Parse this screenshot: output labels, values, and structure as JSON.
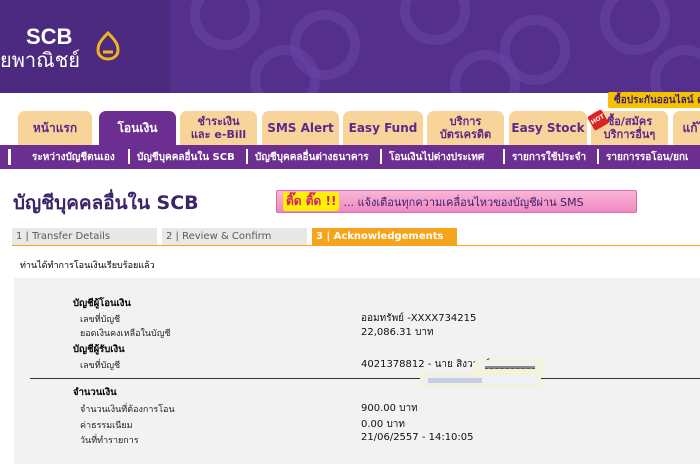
{
  "header": {
    "logo_text": "SCB",
    "logo_subtext": "ยพาณิชย์",
    "insurance_link": "ซื้อประกันออนไลน์ คลิก",
    "hot_badge": "HOT"
  },
  "tabs": [
    {
      "label": "หน้าแรก"
    },
    {
      "label": "โอนเงิน"
    },
    {
      "label": "ชำระเงิน\nและ e-Bill"
    },
    {
      "label": "SMS Alert"
    },
    {
      "label": "Easy Fund"
    },
    {
      "label": "บริการ\nบัตรเครดิต"
    },
    {
      "label": "Easy Stock"
    },
    {
      "label": "ซื้อ/สมัคร\nบริการอื่นๆ"
    },
    {
      "label": "แก้ไ"
    }
  ],
  "subnav": [
    {
      "label": "ระหว่างบัญชีตนเอง"
    },
    {
      "label": "บัญชีบุคคลอื่นใน SCB"
    },
    {
      "label": "บัญชีบุคคลอื่นต่างธนาคาร"
    },
    {
      "label": "โอนเงินไปต่างประเทศ"
    },
    {
      "label": "รายการใช้ประจำ"
    },
    {
      "label": "รายการรอโอน/ยกเ"
    }
  ],
  "page": {
    "title": "บัญชีบุคคลอื่นใน SCB",
    "sms_badge": "ติ๊ด ติ๊ด !!",
    "sms_text": "... แจ้งเตือนทุกความเคลื่อนไหวของบัญชีผ่าน SMS"
  },
  "steps": [
    {
      "label": "1 | Transfer Details"
    },
    {
      "label": "2 | Review & Confirm"
    },
    {
      "label": "3 | Acknowledgements"
    }
  ],
  "confirmation": {
    "message": "ท่านได้ทำการโอนเงินเรียบร้อยแล้ว",
    "from_heading": "บัญชีผู้โอนเงิน",
    "from_account_label": "เลขที่บัญชี",
    "from_account_value": "ออมทรัพย์ -XXXX734215",
    "balance_label": "ยอดเงินคงเหลือในบัญชี",
    "balance_value": "22,086.31 บาท",
    "to_heading": "บัญชีผู้รับเงิน",
    "to_account_label": "เลขที่บัญชี",
    "to_account_value": "4021378812 - นาย สิงวาลย์",
    "amount_heading": "จำนวนเงิน",
    "amount_label": "จำนวนเงินที่ต้องการโอน",
    "amount_value": "900.00 บาท",
    "fee_label": "ค่าธรรมเนียม",
    "fee_value": "0.00 บาท",
    "date_label": "วันที่ทำรายการ",
    "date_value": "21/06/2557 - 14:10:05"
  },
  "colors": {
    "brand_purple": "#4b2a7f",
    "nav_purple": "#6d2e91",
    "tab_peach": "#f8d39a",
    "step_orange": "#f5a41c",
    "sms_pink": "#f4a3cf"
  }
}
